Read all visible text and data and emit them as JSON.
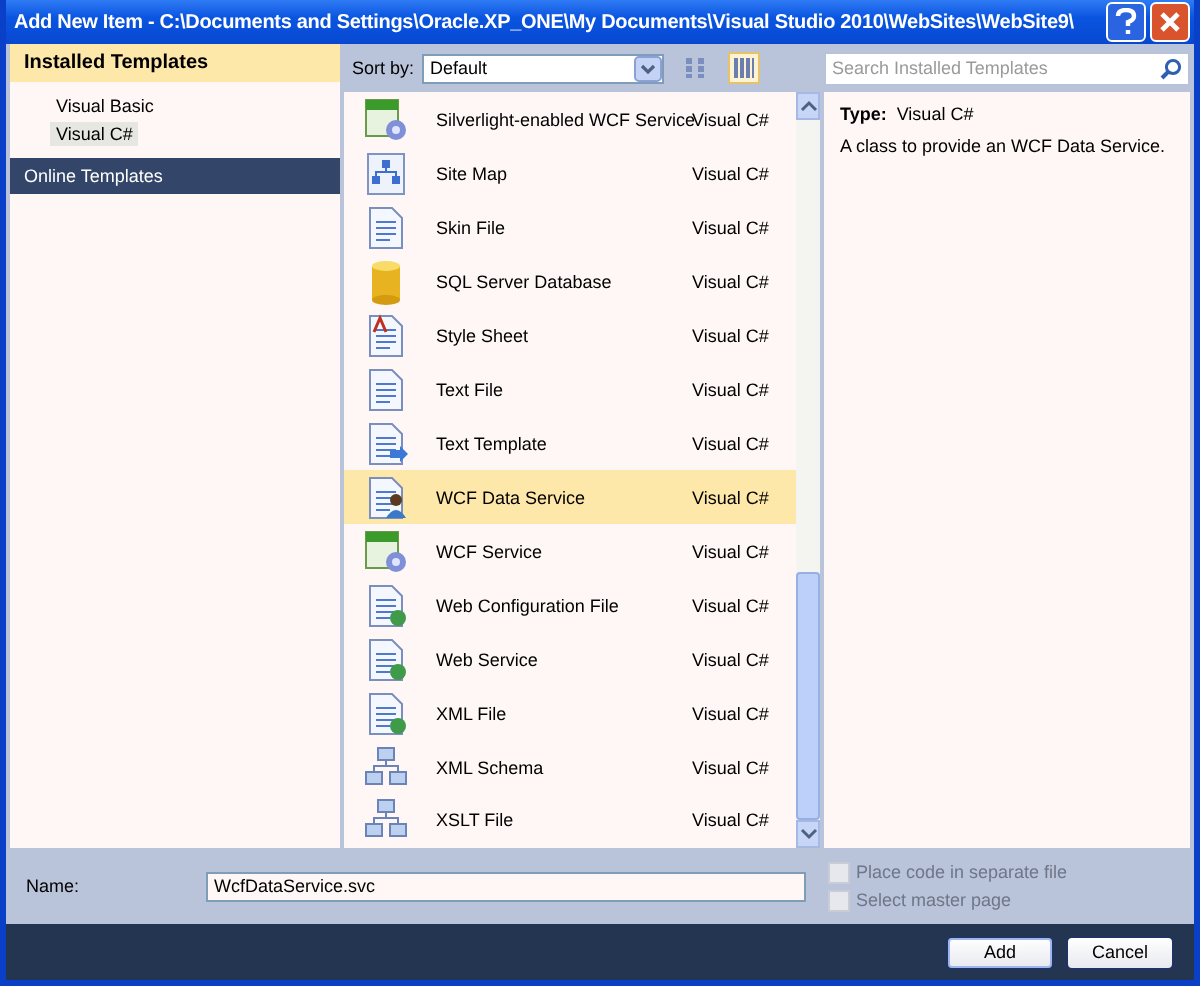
{
  "window": {
    "title": "Add New Item - C:\\Documents and Settings\\Oracle.XP_ONE\\My Documents\\Visual Studio 2010\\WebSites\\WebSite9\\"
  },
  "sidebar": {
    "header": "Installed Templates",
    "items": [
      {
        "label": "Visual Basic",
        "selected": false
      },
      {
        "label": "Visual C#",
        "selected": true
      }
    ],
    "online": "Online Templates"
  },
  "toolbar": {
    "sort_label": "Sort by:",
    "sort_value": "Default",
    "views": [
      {
        "selected": false
      },
      {
        "selected": true
      }
    ]
  },
  "search": {
    "placeholder": "Search Installed Templates"
  },
  "templates": [
    {
      "name": "Silverlight-enabled WCF Service",
      "language": "Visual C#",
      "selected": false
    },
    {
      "name": "Site Map",
      "language": "Visual C#",
      "selected": false
    },
    {
      "name": "Skin File",
      "language": "Visual C#",
      "selected": false
    },
    {
      "name": "SQL Server Database",
      "language": "Visual C#",
      "selected": false
    },
    {
      "name": "Style Sheet",
      "language": "Visual C#",
      "selected": false
    },
    {
      "name": "Text File",
      "language": "Visual C#",
      "selected": false
    },
    {
      "name": "Text Template",
      "language": "Visual C#",
      "selected": false
    },
    {
      "name": "WCF Data Service",
      "language": "Visual C#",
      "selected": true
    },
    {
      "name": "WCF Service",
      "language": "Visual C#",
      "selected": false
    },
    {
      "name": "Web Configuration File",
      "language": "Visual C#",
      "selected": false
    },
    {
      "name": "Web Service",
      "language": "Visual C#",
      "selected": false
    },
    {
      "name": "XML File",
      "language": "Visual C#",
      "selected": false
    },
    {
      "name": "XML Schema",
      "language": "Visual C#",
      "selected": false
    },
    {
      "name": "XSLT File",
      "language": "Visual C#",
      "selected": false
    }
  ],
  "details": {
    "type_label": "Type:",
    "type_value": "Visual C#",
    "description": "A class to provide an WCF Data Service."
  },
  "name_field": {
    "label": "Name:",
    "value": "WcfDataService.svc"
  },
  "options": [
    {
      "label": "Place code in separate file",
      "checked": false,
      "disabled": true
    },
    {
      "label": "Select master page",
      "checked": false,
      "disabled": true
    }
  ],
  "buttons": [
    "Add",
    "Cancel"
  ]
}
